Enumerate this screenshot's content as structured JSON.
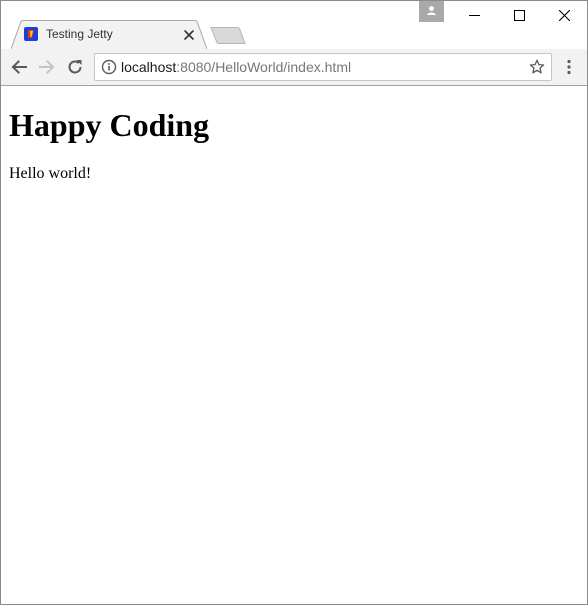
{
  "tab": {
    "title": "Testing Jetty",
    "favicon": "jetty-favicon-icon"
  },
  "window_controls": {
    "profile": "profile-icon",
    "minimize": "minimize-icon",
    "maximize": "maximize-icon",
    "close": "close-icon"
  },
  "toolbar": {
    "back": "back-arrow-icon",
    "forward": "forward-arrow-icon",
    "reload": "reload-icon",
    "url_host": "localhost",
    "url_rest": ":8080/HelloWorld/index.html",
    "bookmark": "star-icon",
    "menu": "menu-dots-icon"
  },
  "page": {
    "heading": "Happy Coding",
    "text": "Hello world!"
  },
  "colors": {
    "toolbar_bg": "#f2f2f2",
    "profile_bg": "#a9a9a9",
    "favicon_blue": "#1c3fd6",
    "favicon_red": "#e8322a"
  }
}
